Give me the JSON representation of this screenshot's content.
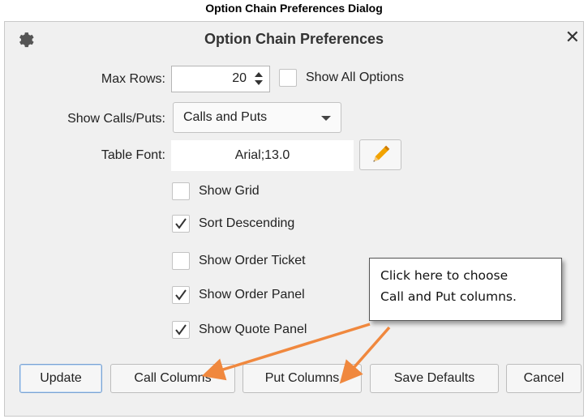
{
  "caption": "Option Chain Preferences Dialog",
  "dialog": {
    "title": "Option Chain Preferences",
    "close_glyph": "✕",
    "icons": {
      "settings": "gear-icon",
      "close": "close-icon",
      "edit_font": "pencil-icon"
    }
  },
  "max_rows": {
    "label": "Max Rows:",
    "value": "20"
  },
  "show_all_options": {
    "label": "Show All Options",
    "checked": false
  },
  "show_calls_puts": {
    "label": "Show Calls/Puts:",
    "selected": "Calls and Puts"
  },
  "table_font": {
    "label": "Table Font:",
    "value": "Arial;13.0"
  },
  "checkboxes": [
    {
      "label": "Show Grid",
      "checked": false
    },
    {
      "label": "Sort Descending",
      "checked": true
    },
    {
      "label": "Show Order Ticket",
      "checked": false
    },
    {
      "label": "Show Order Panel",
      "checked": true
    },
    {
      "label": "Show Quote Panel",
      "checked": true
    }
  ],
  "buttons": {
    "update": "Update",
    "call_columns": "Call Columns",
    "put_columns": "Put Columns",
    "save_defaults": "Save Defaults",
    "cancel": "Cancel"
  },
  "callout": {
    "line1": "Click here to choose",
    "line2": "Call and Put columns."
  },
  "colors": {
    "accent_arrow": "#f0883e",
    "pencil": "#f2a300",
    "default_button_border": "#7aa3d3"
  }
}
